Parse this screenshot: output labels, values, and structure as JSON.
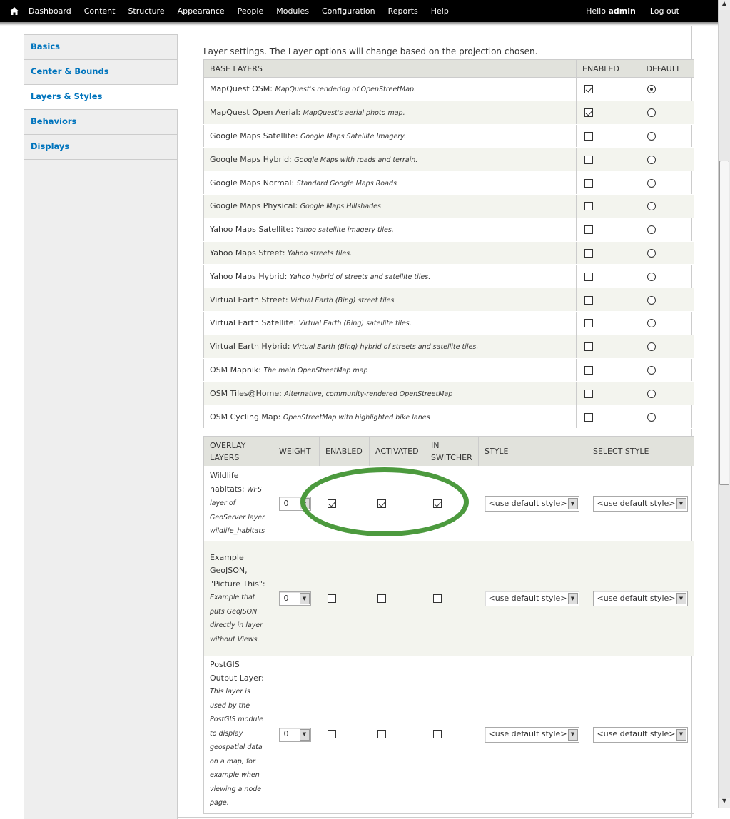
{
  "toolbar": {
    "home_icon": "home-icon",
    "items": [
      "Dashboard",
      "Content",
      "Structure",
      "Appearance",
      "People",
      "Modules",
      "Configuration",
      "Reports",
      "Help"
    ],
    "hello_text": "Hello",
    "username": "admin",
    "logout": "Log out"
  },
  "tabs": [
    {
      "label": "Basics",
      "active": false
    },
    {
      "label": "Center & Bounds",
      "active": false
    },
    {
      "label": "Layers & Styles",
      "active": true
    },
    {
      "label": "Behaviors",
      "active": false
    },
    {
      "label": "Displays",
      "active": false
    }
  ],
  "description": "Layer settings. The Layer options will change based on the projection chosen.",
  "base_layers": {
    "headers": [
      "BASE LAYERS",
      "ENABLED",
      "DEFAULT"
    ],
    "rows": [
      {
        "name": "MapQuest OSM:",
        "desc": "MapQuest's rendering of OpenStreetMap.",
        "enabled": true,
        "default": true
      },
      {
        "name": "MapQuest Open Aerial:",
        "desc": "MapQuest's aerial photo map.",
        "enabled": true,
        "default": false
      },
      {
        "name": "Google Maps Satellite:",
        "desc": "Google Maps Satellite Imagery.",
        "enabled": false,
        "default": false
      },
      {
        "name": "Google Maps Hybrid:",
        "desc": "Google Maps with roads and terrain.",
        "enabled": false,
        "default": false
      },
      {
        "name": "Google Maps Normal:",
        "desc": "Standard Google Maps Roads",
        "enabled": false,
        "default": false
      },
      {
        "name": "Google Maps Physical:",
        "desc": "Google Maps Hillshades",
        "enabled": false,
        "default": false
      },
      {
        "name": "Yahoo Maps Satellite:",
        "desc": "Yahoo satellite imagery tiles.",
        "enabled": false,
        "default": false
      },
      {
        "name": "Yahoo Maps Street:",
        "desc": "Yahoo streets tiles.",
        "enabled": false,
        "default": false
      },
      {
        "name": "Yahoo Maps Hybrid:",
        "desc": "Yahoo hybrid of streets and satellite tiles.",
        "enabled": false,
        "default": false
      },
      {
        "name": "Virtual Earth Street:",
        "desc": "Virtual Earth (Bing) street tiles.",
        "enabled": false,
        "default": false
      },
      {
        "name": "Virtual Earth Satellite:",
        "desc": "Virtual Earth (Bing) satellite tiles.",
        "enabled": false,
        "default": false
      },
      {
        "name": "Virtual Earth Hybrid:",
        "desc": "Virtual Earth (Bing) hybrid of streets and satellite tiles.",
        "enabled": false,
        "default": false
      },
      {
        "name": "OSM Mapnik:",
        "desc": "The main OpenStreetMap map",
        "enabled": false,
        "default": false
      },
      {
        "name": "OSM Tiles@Home:",
        "desc": "Alternative, community-rendered OpenStreetMap",
        "enabled": false,
        "default": false
      },
      {
        "name": "OSM Cycling Map:",
        "desc": "OpenStreetMap with highlighted bike lanes",
        "enabled": false,
        "default": false
      }
    ]
  },
  "overlay_layers": {
    "headers": {
      "overlay": "OVERLAY LAYERS",
      "weight": "WEIGHT",
      "enabled": "ENABLED",
      "activated": "ACTIVATED",
      "in_switcher": "IN SWITCHER",
      "style": "STYLE",
      "select_style": "SELECT STYLE"
    },
    "rows": [
      {
        "name": "Wildlife habitats:",
        "desc": "WFS layer of GeoServer layer wildlife_habitats",
        "weight": "0",
        "enabled": true,
        "activated": true,
        "in_switcher": true,
        "style": "<use default style>",
        "select_style": "<use default style>"
      },
      {
        "name": "Example GeoJSON, \"Picture This\":",
        "desc": "Example that puts GeoJSON directly in layer without Views.",
        "weight": "0",
        "enabled": false,
        "activated": false,
        "in_switcher": false,
        "style": "<use default style>",
        "select_style": "<use default style>"
      },
      {
        "name": "PostGIS Output Layer:",
        "desc": "This layer is used by the PostGIS module to display geospatial data on a map, for example when viewing a node page.",
        "weight": "0",
        "enabled": false,
        "activated": false,
        "in_switcher": false,
        "style": "<use default style>",
        "select_style": "<use default style>"
      }
    ]
  },
  "colors": {
    "highlight_ring": "#4c9a3e",
    "tab_link": "#0074bd",
    "toolbar_bg": "#000000"
  }
}
